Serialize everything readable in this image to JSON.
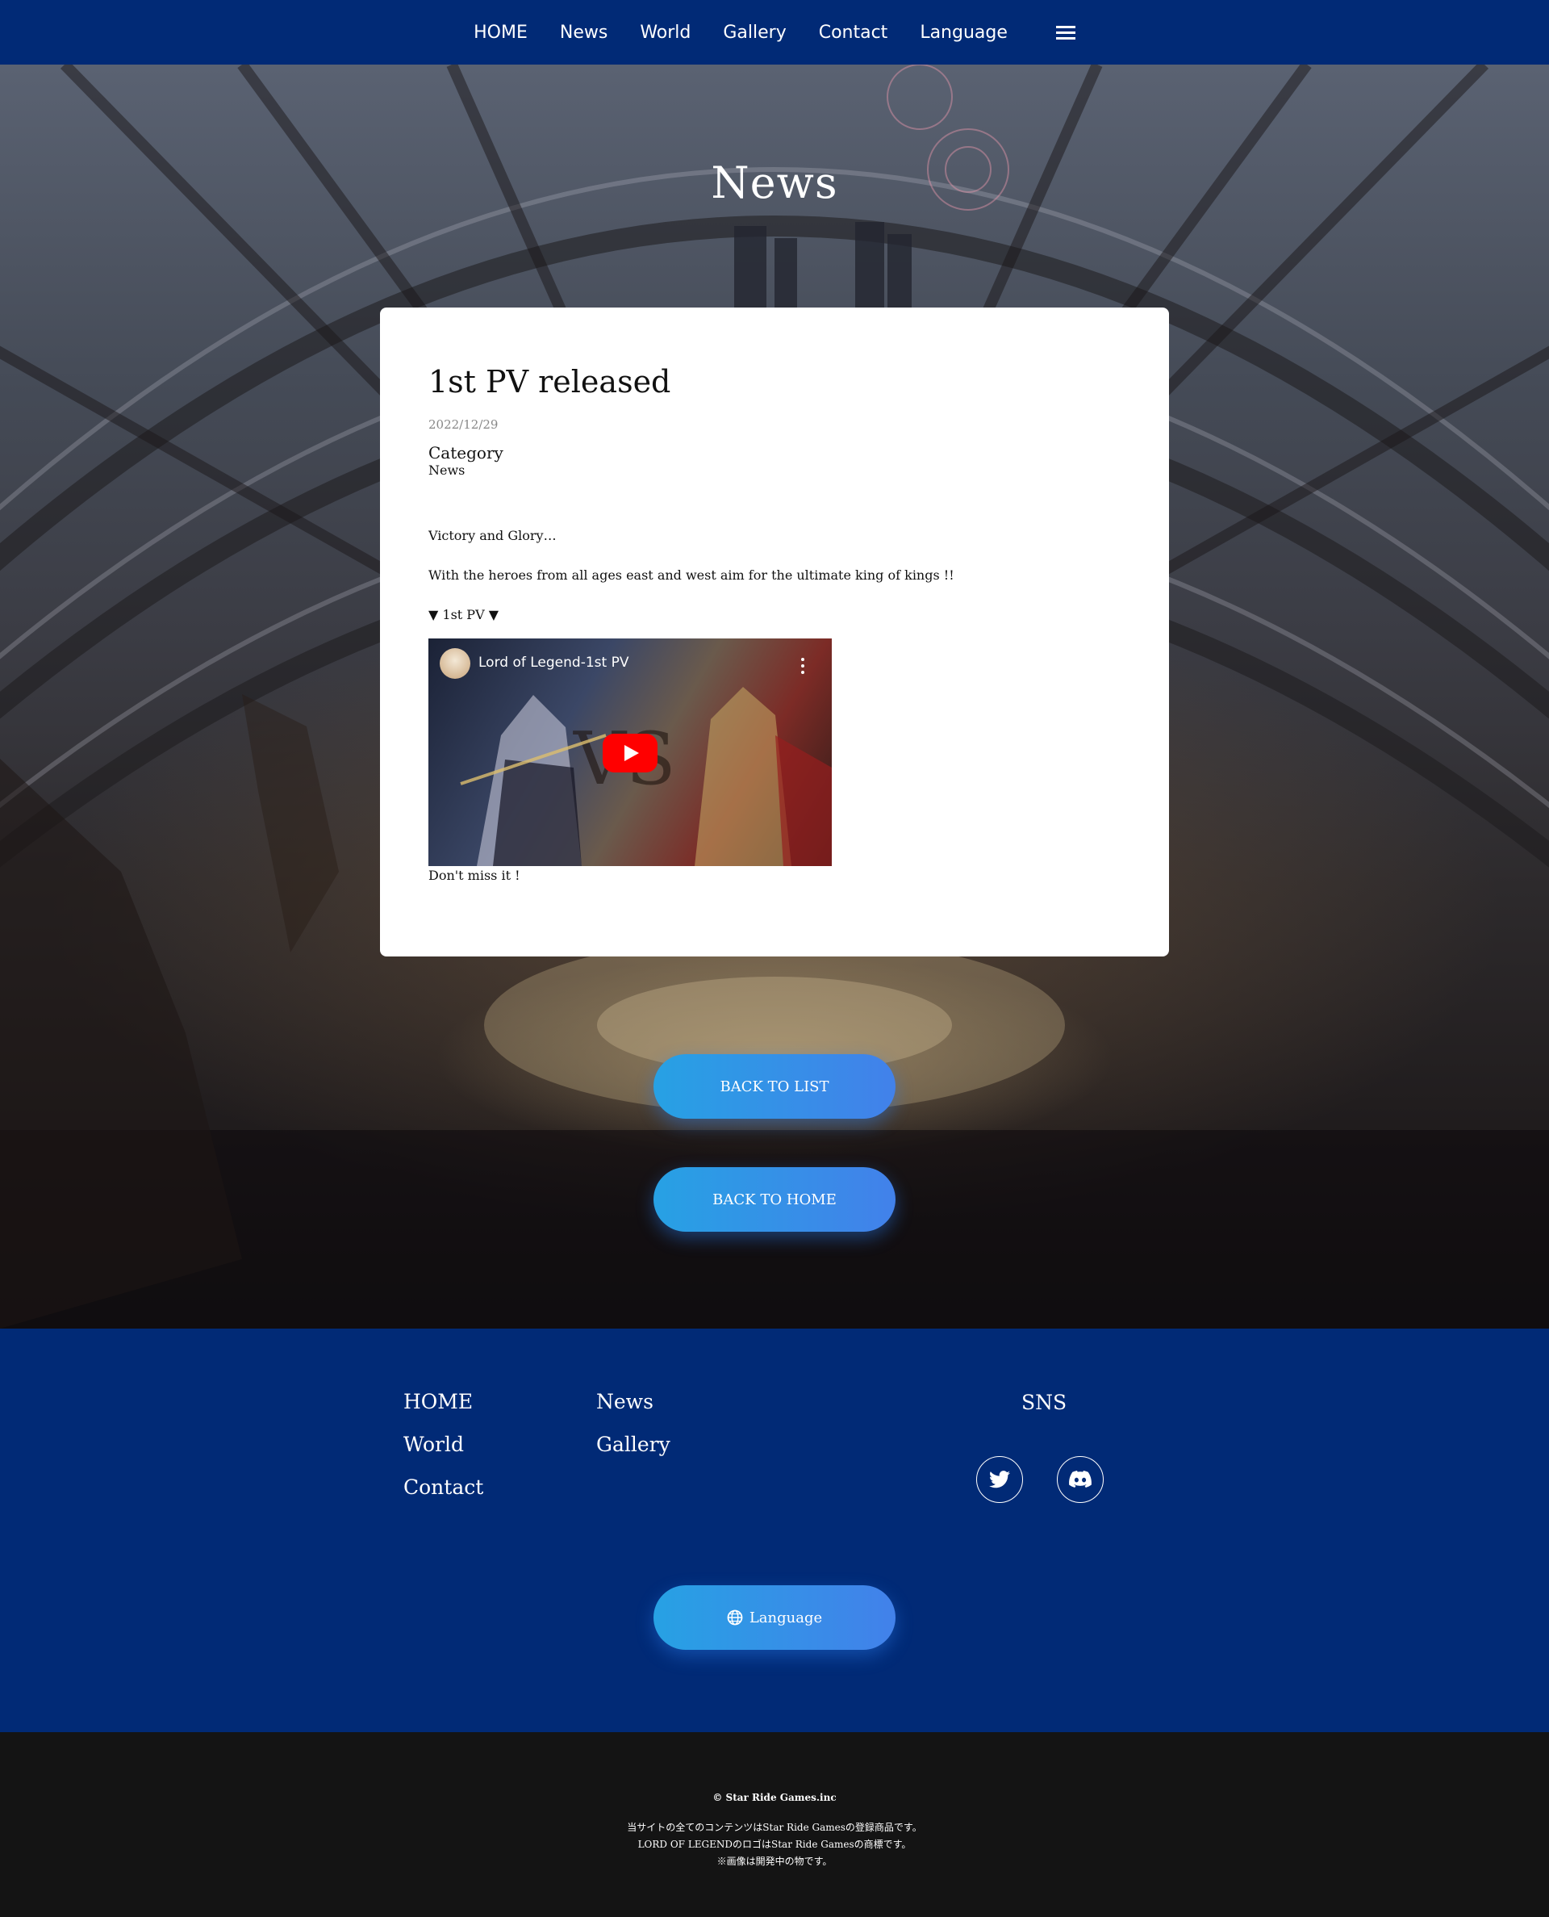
{
  "nav": {
    "items": [
      {
        "label": "HOME"
      },
      {
        "label": "News"
      },
      {
        "label": "World"
      },
      {
        "label": "Gallery"
      },
      {
        "label": "Contact"
      },
      {
        "label": "Language"
      }
    ],
    "menu_icon": "hamburger-icon"
  },
  "hero": {
    "title": "News"
  },
  "article": {
    "title": "1st PV released",
    "date": "2022/12/29",
    "category_label": "Category",
    "category_value": "News",
    "paragraphs": [
      "Victory and Glory…",
      "With the heroes from all ages east and west aim for the ultimate king of kings !!",
      "▼ 1st PV ▼",
      "Don't miss it !"
    ],
    "video": {
      "title": "Lord of Legend-1st PV",
      "play_icon": "youtube-play-icon"
    }
  },
  "buttons": {
    "back_to_list": "BACK TO LIST",
    "back_to_home": "BACK TO HOME"
  },
  "footer": {
    "links": [
      {
        "label": "HOME"
      },
      {
        "label": "News"
      },
      {
        "label": "World"
      },
      {
        "label": "Gallery"
      },
      {
        "label": "Contact"
      }
    ],
    "sns_label": "SNS",
    "sns_icons": [
      "twitter-icon",
      "discord-icon"
    ],
    "language_button": "Language"
  },
  "bottom": {
    "copyright": "© Star Ride Games.inc",
    "legal_lines": [
      "当サイトの全てのコンテンツはStar Ride Gamesの登録商品です。",
      "LORD OF LEGENDのロゴはStar Ride Gamesの商標です。",
      "※画像は開発中の物です。"
    ]
  },
  "colors": {
    "nav_bg": "#012a76",
    "footer_bg": "#012a76",
    "bottom_bg": "#141414",
    "button_gradient_start": "#27a1e4",
    "button_gradient_end": "#4281ea",
    "youtube_red": "#ff0000"
  }
}
